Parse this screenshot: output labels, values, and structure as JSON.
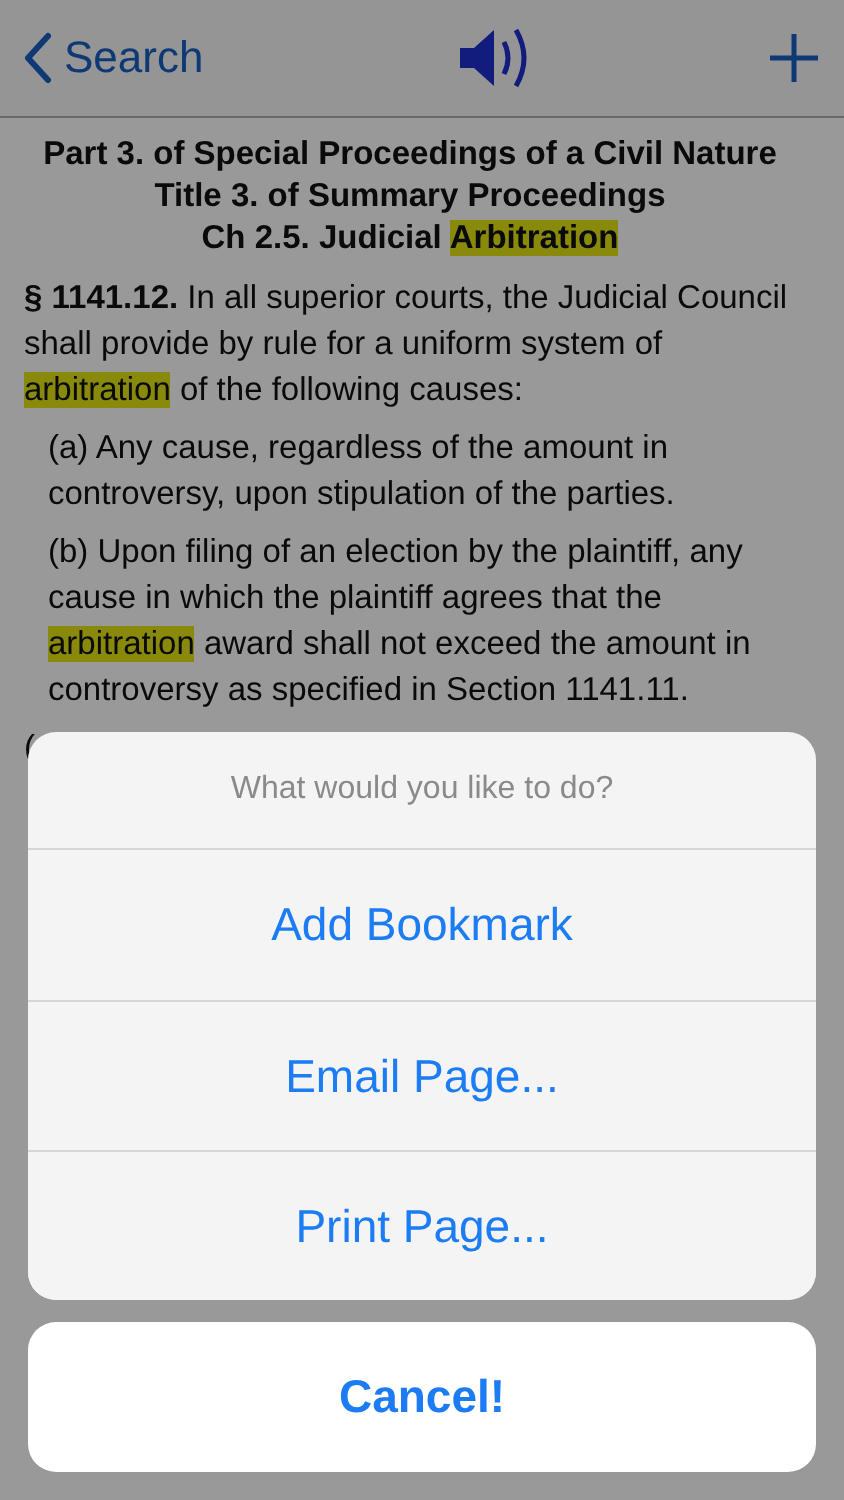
{
  "nav_bar": {
    "back_label": "Search"
  },
  "headings": [
    "Part 3. of Special Proceedings of a Civil Nature",
    "Title 3. of Summary Proceedings",
    [
      {
        "text": "Ch 2.5. Judicial ",
        "highlighted": false
      },
      {
        "text": "Arbitration",
        "highlighted": true
      }
    ]
  ],
  "paragraphs": [
    {
      "kind": "section",
      "parts": [
        {
          "text": "**§ 1141.12.** In all superior courts, the Judicial Council shall provide by rule for a uniform system of ",
          "highlighted": false
        },
        {
          "text": "arbitration",
          "highlighted": true
        },
        {
          "text": " of the following causes:",
          "highlighted": false
        }
      ]
    },
    {
      "kind": "clause",
      "parts": [
        {
          "text": "(a) Any cause, regardless of the amount in controversy, upon stipulation of the parties.",
          "highlighted": false
        }
      ]
    },
    {
      "kind": "clause",
      "parts": [
        {
          "text": "(b) Upon filing of an election by the plaintiff, any cause in which the plaintiff agrees that the ",
          "highlighted": false
        },
        {
          "text": "arbitration",
          "highlighted": true
        },
        {
          "text": " award shall not exceed the amount in controversy as specified in Section 1141.11.",
          "highlighted": false
        }
      ]
    },
    {
      "kind": "note",
      "parts": [
        {
          "text": "(",
          "highlighted": false
        }
      ]
    }
  ],
  "action_sheet": {
    "title": "What would you like to do?",
    "actions": [
      "Add Bookmark",
      "Email Page...",
      "Print Page..."
    ],
    "cancel": "Cancel!"
  }
}
